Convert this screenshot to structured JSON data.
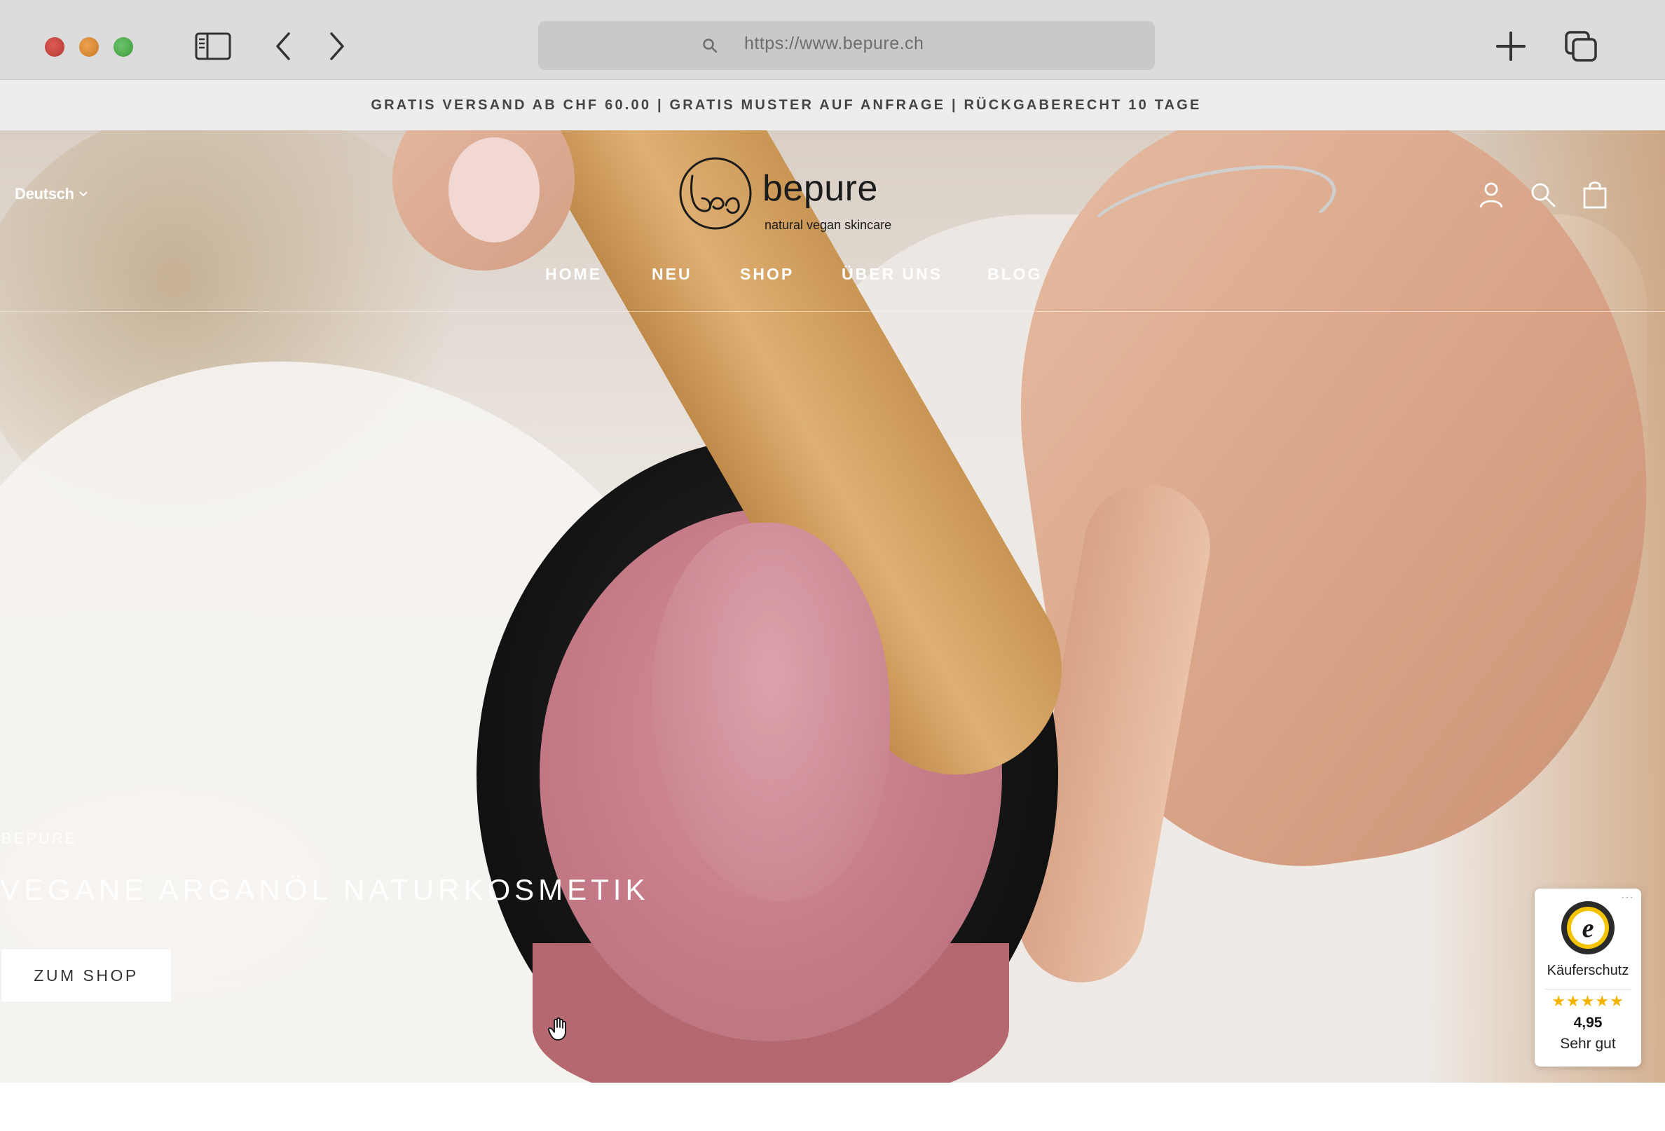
{
  "browser": {
    "url": "https://www.bepure.ch"
  },
  "announcement": {
    "text": "GRATIS VERSAND AB CHF 60.00 | GRATIS MUSTER AUF ANFRAGE | RÜCKGABERECHT 10 TAGE"
  },
  "header": {
    "language": "Deutsch",
    "logo": {
      "brand": "bepure",
      "tagline": "natural vegan skincare"
    },
    "nav": [
      "HOME",
      "NEU",
      "SHOP",
      "ÜBER UNS",
      "BLOG"
    ],
    "icons": [
      "account-icon",
      "search-icon",
      "shopping-bag-icon"
    ]
  },
  "hero": {
    "kicker": "BEPURE",
    "headline": "VEGANE ARGANÖL NATURKOSMETIK",
    "cta": "ZUM SHOP"
  },
  "trust_badge": {
    "label": "Käuferschutz",
    "stars": "★★★★★",
    "score": "4,95",
    "rating_text": "Sehr gut",
    "menu": "···"
  },
  "colors": {
    "chrome": "#dcdcdc",
    "announcement_bg": "#ededed",
    "star": "#f5b301",
    "nav_text": "#ffffff"
  }
}
